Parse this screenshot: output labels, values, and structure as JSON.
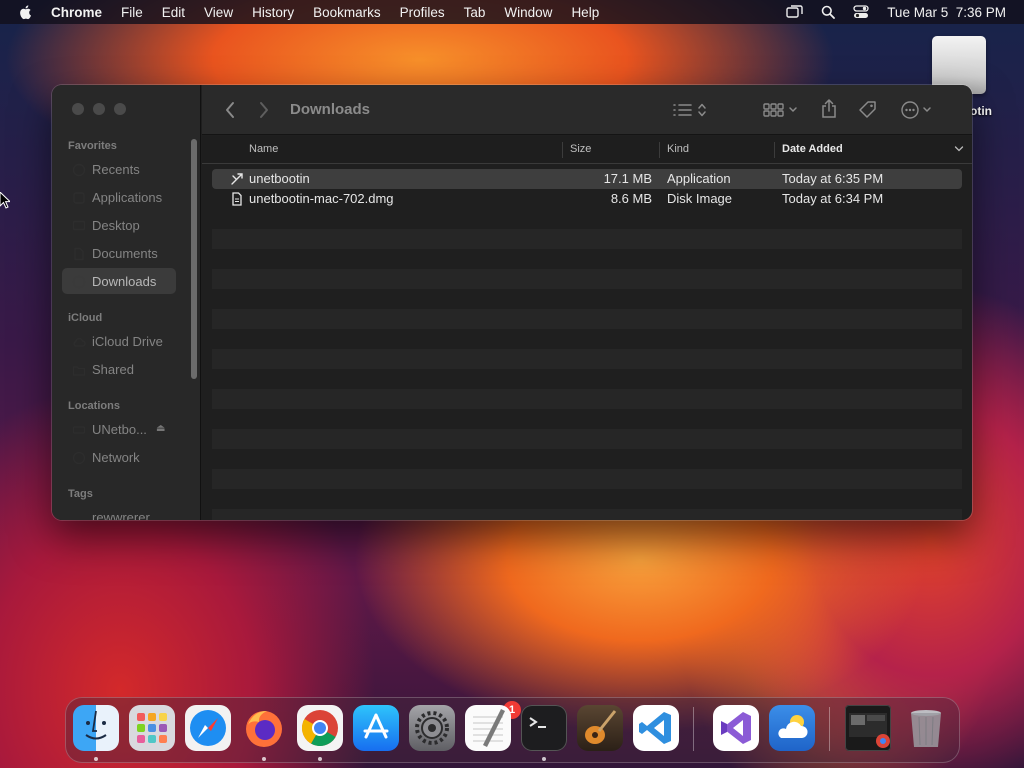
{
  "menubar": {
    "app_name": "Chrome",
    "items": [
      "File",
      "Edit",
      "View",
      "History",
      "Bookmarks",
      "Profiles",
      "Tab",
      "Window",
      "Help"
    ],
    "clock": "Tue Mar 5  7:36 PM",
    "status_icons": [
      "screen-mirroring-icon",
      "search-icon",
      "control-center-icon"
    ]
  },
  "desktop": {
    "icon_label": "otin",
    "icon_name": "removable-disk-icon"
  },
  "finder": {
    "title": "Downloads",
    "sidebar": {
      "favorites_heading": "Favorites",
      "favorites": [
        "Recents",
        "Applications",
        "Desktop",
        "Documents",
        "Downloads"
      ],
      "selected": "Downloads",
      "icloud_heading": "iCloud",
      "icloud": [
        "iCloud Drive",
        "Shared"
      ],
      "locations_heading": "Locations",
      "locations": [
        "UNetbo...",
        "Network"
      ],
      "tags_heading": "Tags",
      "tags": [
        "rewwrerer"
      ]
    },
    "columns": {
      "name": "Name",
      "size": "Size",
      "kind": "Kind",
      "date_added": "Date Added",
      "sorted_by": "Date Added"
    },
    "files": [
      {
        "name": "unetbootin",
        "size": "17.1 MB",
        "kind": "Application",
        "date": "Today at 6:35 PM",
        "icon": "application-icon",
        "selected": true
      },
      {
        "name": "unetbootin-mac-702.dmg",
        "size": "8.6 MB",
        "kind": "Disk Image",
        "date": "Today at 6:34 PM",
        "icon": "document-icon",
        "selected": false
      }
    ]
  },
  "dock": {
    "apps": [
      "Finder",
      "Launchpad",
      "Safari",
      "Firefox",
      "Google Chrome",
      "App Store",
      "System Settings",
      "TextEdit",
      "Terminal",
      "GarageBand",
      "Visual Studio Code",
      "Visual Studio",
      "Weather"
    ],
    "system_settings_badge": "1",
    "running": [
      "Finder",
      "Firefox",
      "Google Chrome",
      "Terminal"
    ],
    "recent_items": [
      "Chrome window preview"
    ],
    "trash": "Trash"
  },
  "colors": {
    "finder_bg": "#1f1f1f",
    "sidebar_bg": "#282828",
    "selection": "#3e3e3e",
    "badge": "#f03a35"
  }
}
